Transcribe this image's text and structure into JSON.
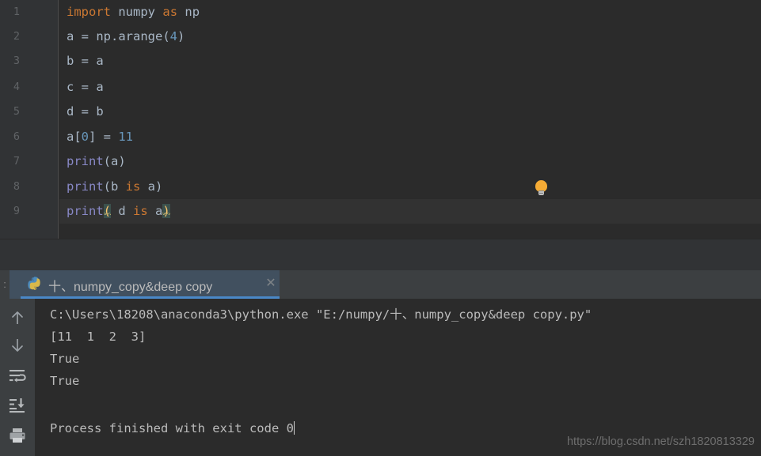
{
  "editor": {
    "line_numbers": [
      "1",
      "2",
      "3",
      "4",
      "5",
      "6",
      "7",
      "8",
      "9"
    ],
    "current_line": 9,
    "lines": [
      {
        "n": 1,
        "tokens": [
          {
            "t": "import",
            "c": "kw"
          },
          {
            "t": " ",
            "c": "plain"
          },
          {
            "t": "numpy",
            "c": "plain"
          },
          {
            "t": " ",
            "c": "plain"
          },
          {
            "t": "as",
            "c": "kw"
          },
          {
            "t": " ",
            "c": "plain"
          },
          {
            "t": "np",
            "c": "plain"
          }
        ]
      },
      {
        "n": 2,
        "tokens": [
          {
            "t": "a = np.arange(",
            "c": "plain"
          },
          {
            "t": "4",
            "c": "num"
          },
          {
            "t": ")",
            "c": "plain"
          }
        ]
      },
      {
        "n": 3,
        "tokens": [
          {
            "t": "b = a",
            "c": "plain"
          }
        ]
      },
      {
        "n": 4,
        "tokens": [
          {
            "t": "c = a",
            "c": "plain"
          }
        ]
      },
      {
        "n": 5,
        "tokens": [
          {
            "t": "d = b",
            "c": "plain"
          }
        ]
      },
      {
        "n": 6,
        "tokens": [
          {
            "t": "a[",
            "c": "plain"
          },
          {
            "t": "0",
            "c": "num"
          },
          {
            "t": "] = ",
            "c": "plain"
          },
          {
            "t": "11",
            "c": "num"
          }
        ]
      },
      {
        "n": 7,
        "tokens": [
          {
            "t": "print",
            "c": "fn"
          },
          {
            "t": "(a)",
            "c": "plain"
          }
        ]
      },
      {
        "n": 8,
        "tokens": [
          {
            "t": "print",
            "c": "fn"
          },
          {
            "t": "(b ",
            "c": "plain"
          },
          {
            "t": "is",
            "c": "kw"
          },
          {
            "t": " a)",
            "c": "plain"
          }
        ]
      },
      {
        "n": 9,
        "tokens": [
          {
            "t": "print",
            "c": "fn"
          },
          {
            "t": "(",
            "c": "brkt"
          },
          {
            "t": " d ",
            "c": "plain"
          },
          {
            "t": "is",
            "c": "kw"
          },
          {
            "t": " a",
            "c": "plain"
          },
          {
            "t": ")",
            "c": "brkt"
          }
        ]
      }
    ],
    "plain_text": [
      "import numpy as np",
      "a = np.arange(4)",
      "b = a",
      "c = a",
      "d = b",
      "a[0] = 11",
      "print(a)",
      "print(b is a)",
      "print( d is a)"
    ],
    "intention_bulb": {
      "icon": "lightbulb-icon",
      "line": 8
    },
    "colors": {
      "background": "#2b2b2b",
      "gutter": "#313335",
      "keyword": "#cc7832",
      "number": "#6897bb",
      "function": "#8888c6",
      "identifier": "#a9b7c6",
      "bracket_match": "#ffc66d",
      "bracket_match_bg": "#3b514d",
      "line_number": "#606366",
      "current_line_bg": "#323232"
    }
  },
  "run_window": {
    "strip_label": ":",
    "tab": {
      "icon": "python-icon",
      "title": "十、numpy_copy&deep copy",
      "close_icon": "close-icon",
      "active": true,
      "underline_color": "#4a88c7",
      "background": "#41505f"
    },
    "toolbar": [
      {
        "icon": "arrow-up-icon",
        "name": "up-the-stack-trace"
      },
      {
        "icon": "arrow-down-icon",
        "name": "down-the-stack-trace"
      },
      {
        "icon": "soft-wrap-icon",
        "name": "soft-wrap"
      },
      {
        "icon": "scroll-to-end-icon",
        "name": "scroll-to-end"
      },
      {
        "icon": "print-icon",
        "name": "print"
      }
    ],
    "console_lines": [
      "C:\\Users\\18208\\anaconda3\\python.exe \"E:/numpy/十、numpy_copy&deep copy.py\"",
      "[11  1  2  3]",
      "True",
      "True",
      "",
      "Process finished with exit code 0"
    ],
    "exit_code_line": "Process finished with exit code 0"
  },
  "watermark": {
    "text": "https://blog.csdn.net/szh1820813329"
  }
}
